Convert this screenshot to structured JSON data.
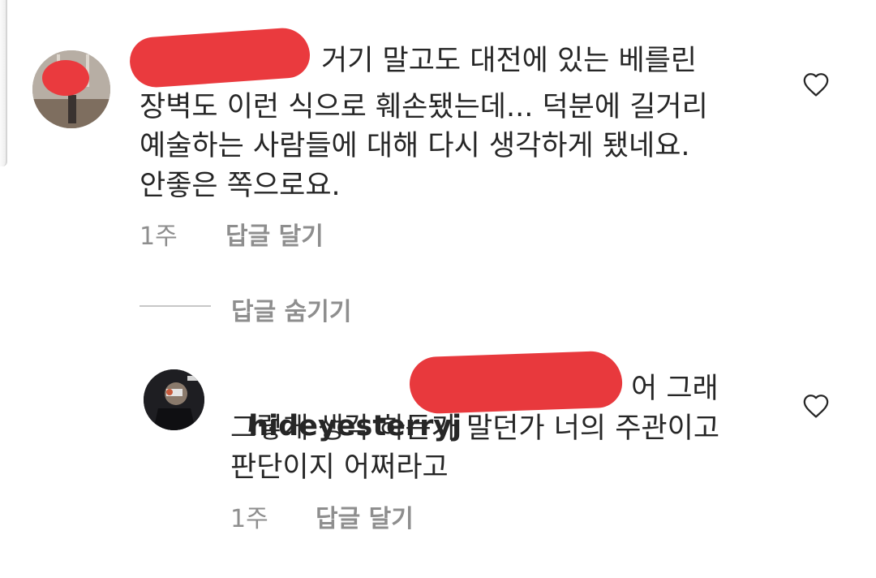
{
  "comment": {
    "lines": [
      "거기 말고도 대전에 있는 베를린",
      "장벽도 이런 식으로 훼손됐는데... 덕분에 길거리",
      "예술하는 사람들에 대해 다시 생각하게 됐네요.",
      "안좋은 쪽으로요."
    ],
    "time": "1주",
    "reply_label": "답글 달기",
    "like_icon": "heart-outline-icon"
  },
  "toggle": {
    "label": "답글 숨기기"
  },
  "reply": {
    "username": "hideyesterryj",
    "lines": [
      "어 그래",
      "그렇게 생각 하든가 말던가 너의 주관이고",
      "판단이지 어쩌라고"
    ],
    "time": "1주",
    "reply_label": "답글 달기",
    "like_icon": "heart-outline-icon"
  },
  "colors": {
    "text": "#262626",
    "meta": "#8e8e8e",
    "redaction": "#e8393d"
  }
}
